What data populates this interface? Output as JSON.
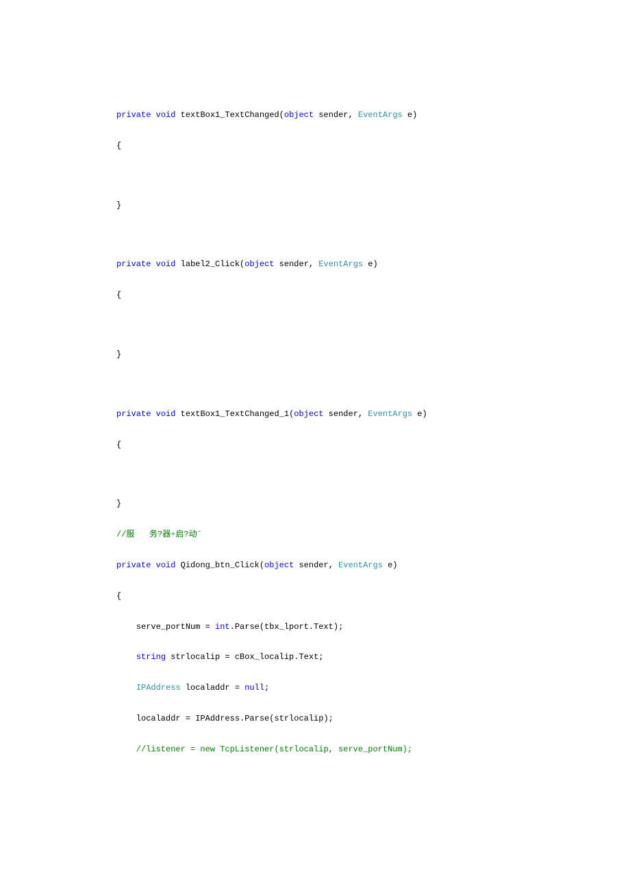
{
  "code": {
    "l1": {
      "a": "private",
      "b": "void",
      "c": " textBox1_TextChanged(",
      "d": "object",
      "e": " sender, ",
      "f": "EventArgs",
      "g": " e)"
    },
    "l2": "{",
    "l3": "}",
    "l4": {
      "a": "private",
      "b": "void",
      "c": " label2_Click(",
      "d": "object",
      "e": " sender, ",
      "f": "EventArgs",
      "g": " e)"
    },
    "l5": "{",
    "l6": "}",
    "l7": {
      "a": "private",
      "b": "void",
      "c": " textBox1_TextChanged_1(",
      "d": "object",
      "e": " sender, ",
      "f": "EventArgs",
      "g": " e)"
    },
    "l8": "{",
    "l9": "}",
    "l10": "//服   务?器÷启?动ˉ",
    "l11": {
      "a": "private",
      "b": "void",
      "c": " Qidong_btn_Click(",
      "d": "object",
      "e": " sender, ",
      "f": "EventArgs",
      "g": " e)"
    },
    "l12": "{",
    "l13": {
      "a": "    serve_portNum = ",
      "b": "int",
      "c": ".Parse(tbx_lport.Text);"
    },
    "l14": {
      "a": "    ",
      "b": "string",
      "c": " strlocalip = cBox_localip.Text;"
    },
    "l15": {
      "a": "    ",
      "b": "IPAddress",
      "c": " localaddr = ",
      "d": "null",
      "e": ";"
    },
    "l16": "    localaddr = IPAddress.Parse(strlocalip);",
    "l17": "    //listener = new TcpListener(strlocalip, serve_portNum);"
  }
}
